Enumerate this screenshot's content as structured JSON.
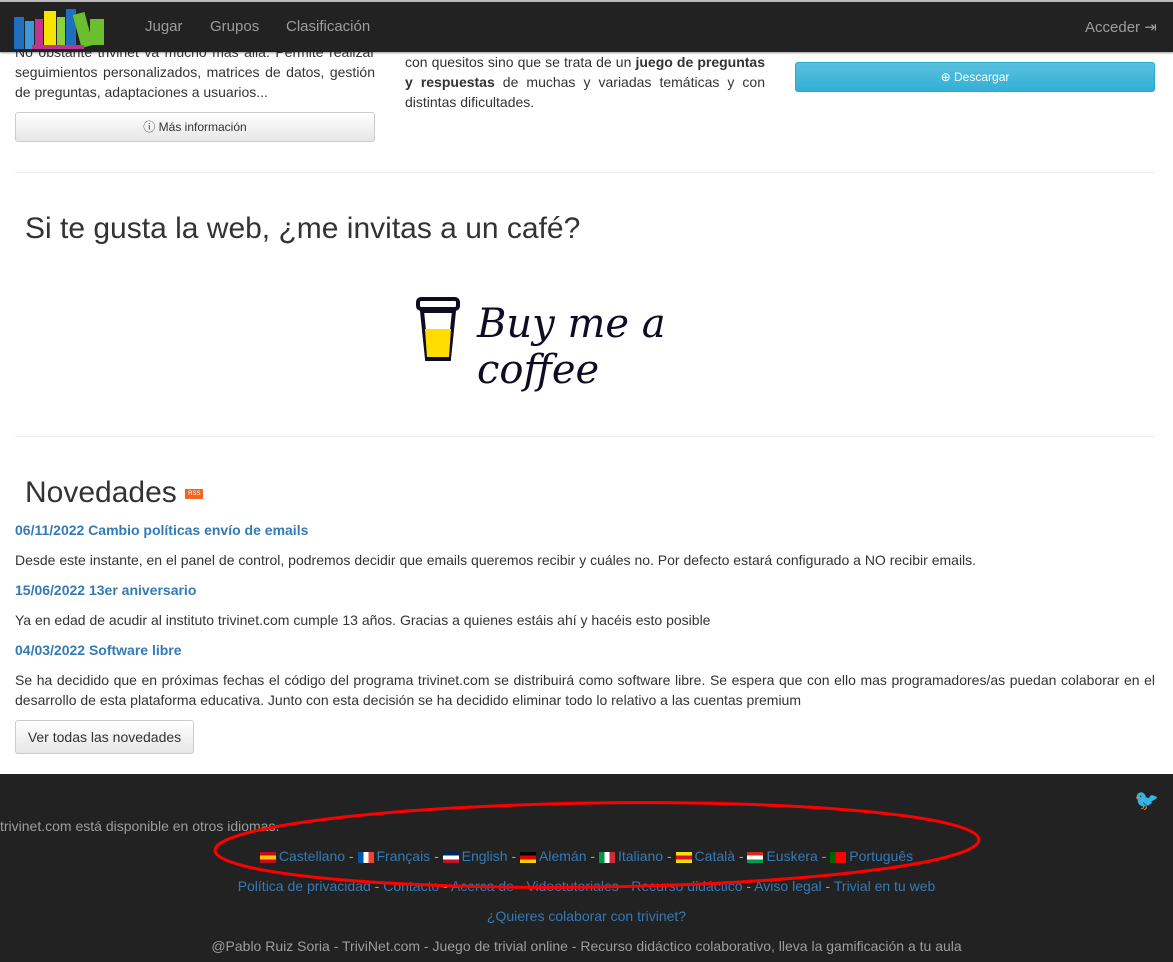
{
  "nav": {
    "items": [
      "Jugar",
      "Grupos",
      "Clasificación"
    ],
    "login": "Acceder"
  },
  "left": {
    "text": "No obstante trivinet va mucho más allá. Permite realizar seguimientos personalizados, matrices de datos, gestión de preguntas, adaptaciones a usuarios...",
    "button": "Más información"
  },
  "middle": {
    "text_a": "con quesitos sino que se trata de un ",
    "text_bold": "juego de preguntas y respuestas",
    "text_b": " de muchas y variadas temáticas y con distintas dificultades."
  },
  "right": {
    "button": "Descargar"
  },
  "coffee": {
    "heading": "Si te gusta la web, ¿me invitas a un café?",
    "logo_text": "Buy me a coffee"
  },
  "news": {
    "heading": "Novedades",
    "rss": "RSS",
    "items": [
      {
        "title": "06/11/2022 Cambio políticas envío de emails",
        "body": "Desde este instante, en el panel de control, podremos decidir que emails queremos recibir y cuáles no. Por defecto estará configurado a NO recibir emails."
      },
      {
        "title": "15/06/2022 13er aniversario",
        "body": "Ya en edad de acudir al instituto trivinet.com cumple 13 años. Gracias a quienes estáis ahí y hacéis esto posible"
      },
      {
        "title": "04/03/2022 Software libre",
        "body": "Se ha decidido que en próximas fechas el código del programa trivinet.com se distribuirá como software libre. Se espera que con ello mas programadores/as puedan colaborar en el desarrollo de esta plataforma educativa. Junto con esta decisión se ha decidido eliminar todo lo relativo a las cuentas premium"
      }
    ],
    "all_button": "Ver todas las novedades"
  },
  "footer": {
    "languages_intro": "trivinet.com está disponible en otros idiomas.",
    "languages": [
      "Castellano",
      "Français",
      "English",
      "Alemán",
      "Italiano",
      "Català",
      "Euskera",
      "Português"
    ],
    "links": [
      "Política de privacidad",
      "Contacto",
      "Acerca de",
      "Videotutoriales",
      "Recurso didáctico",
      "Aviso legal",
      "Trivial en tu web"
    ],
    "collaborate": "¿Quieres colaborar con trivinet?",
    "credits": "@Pablo Ruiz Soria - TriviNet.com - Juego de trivial online - Recurso didáctico colaborativo, lleva la gamificación a tu aula"
  },
  "annotation_color": "#ff0000"
}
